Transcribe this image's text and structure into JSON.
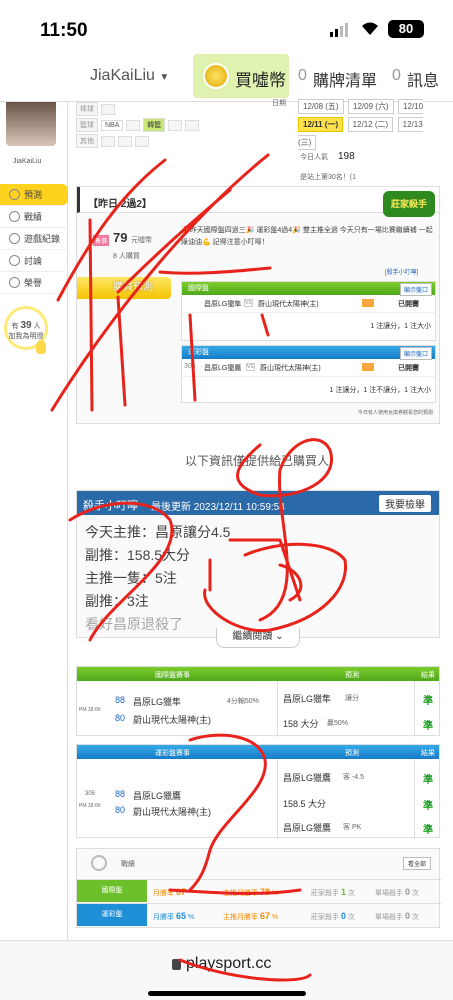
{
  "status_bar": {
    "time": "11:50",
    "battery": "80"
  },
  "nav": {
    "username": "JiaKaiLiu",
    "buy_label": "買噓幣",
    "cart_count": "0",
    "cart_label": "購牌清單",
    "msg_count": "0",
    "msg_label": "訊息"
  },
  "sidebar": {
    "username": "JiaKaiLiu",
    "items": [
      {
        "label": "預測"
      },
      {
        "label": "戰績"
      },
      {
        "label": "遊戲紀錄"
      },
      {
        "label": "討論"
      },
      {
        "label": "榮譽"
      }
    ],
    "fans_prefix": "有",
    "fans_count": "39",
    "fans_suffix": "人",
    "fans_line2": "加我為明燈"
  },
  "filters": {
    "row1_label": "棒球",
    "row2_label": "籃球",
    "row3_label": "其他",
    "row2_tags": [
      "NBA",
      "韓籃"
    ],
    "dates_row1": [
      "12/08 (五)",
      "12/09 (六)",
      "12/10 (日)"
    ],
    "dates_row2": [
      "12/11 (一)",
      "12/12 (二)",
      "12/13 (三)"
    ],
    "date_header": "日期"
  },
  "popularity": {
    "label": "今日人氣",
    "value": "198",
    "rank_text": "是站上第30名！(1"
  },
  "yesterday": {
    "title": "【昨日 2過2】"
  },
  "prediction": {
    "price_value": "79",
    "price_unit": "元噓幣",
    "buyers": "8 人購買",
    "message": "🎉昨天國際盤四過三🎉 運彩盤4過4🎉 雙主推全過 今天只有一場比賽繼續補 一起綠油油💪 記得注意小叮嚀！",
    "buy_button": "購買預測",
    "kill_link": "[殺手小叮嚀]"
  },
  "intl_box": {
    "header": "國際盤",
    "show_btn": "顯示盤口",
    "team1": "昌原LG獵隼",
    "team2": "蔚山現代太陽神(主)",
    "status": "已開賽",
    "summary": "1 注讓分，1 注大小"
  },
  "lottery_box": {
    "header": "運彩盤",
    "show_btn": "顯示盤口",
    "game_no": "305",
    "team1": "昌原LG獵鷹",
    "team2": "蔚山現代太陽神(主)",
    "status": "已開賽",
    "summary": "1 注讓分，1 注不讓分，1 注大小"
  },
  "refund_note": "今日有人使用兌換券觀看您的預測",
  "info_line": "以下資訊僅提供給已購買人",
  "tips": {
    "title": "殺手小叮嚀",
    "updated": "最後更新 2023/12/11 10:59:54",
    "report_btn": "我要檢舉",
    "lines": [
      "今天主推：昌原讓分4.5",
      "副推：158.5大分",
      "主推一隻：5注",
      "副推：3注",
      "看好昌原退殺了"
    ],
    "read_more": "繼續閱讀"
  },
  "intl_table": {
    "h1": "國際盤賽事",
    "h2": "預測",
    "h3": "結果",
    "time": "PM 18:00",
    "num1": "88",
    "num2": "80",
    "team1": "昌原LG獵隼",
    "team2": "蔚山現代太陽神(主)",
    "note1": "4分輸50%",
    "pred1": "昌原LG獵隼",
    "pred1_tag": "讓分",
    "pred2": "158 大分",
    "pred2_tag": "贏50%",
    "res1": "準",
    "res2": "準"
  },
  "lottery_table": {
    "h1": "運彩盤賽事",
    "h2": "預測",
    "h3": "結果",
    "game_no": "305",
    "time": "PM 18:00",
    "num1": "88",
    "num2": "80",
    "team1": "昌原LG獵鷹",
    "team2": "蔚山現代太陽神(主)",
    "pred1": "昌原LG獵鷹",
    "pred1_tag": "客 -4.5",
    "pred2": "158.5 大分",
    "pred3": "昌原LG獵鷹",
    "pred3_tag": "客 PK",
    "res1": "準",
    "res2": "準",
    "res3": "準"
  },
  "record": {
    "title": "戰績",
    "see_all": "看全部",
    "rows": [
      {
        "label": "國際盤",
        "month_rate_label": "月勝率",
        "month_rate": "67",
        "main_label": "主推月勝率",
        "main_rate": "78",
        "dealer_label": "莊家殺手",
        "dealer": "1",
        "single_label": "單場殺手",
        "single": "0",
        "color": "#6cc12a"
      },
      {
        "label": "運彩盤",
        "month_rate_label": "月勝率",
        "month_rate": "65",
        "main_label": "主推月勝率",
        "main_rate": "67",
        "dealer_label": "莊家殺手",
        "dealer": "0",
        "single_label": "單場殺手",
        "single": "0",
        "color": "#1f8fd8"
      }
    ]
  },
  "footer": {
    "url": "playsport.cc"
  }
}
